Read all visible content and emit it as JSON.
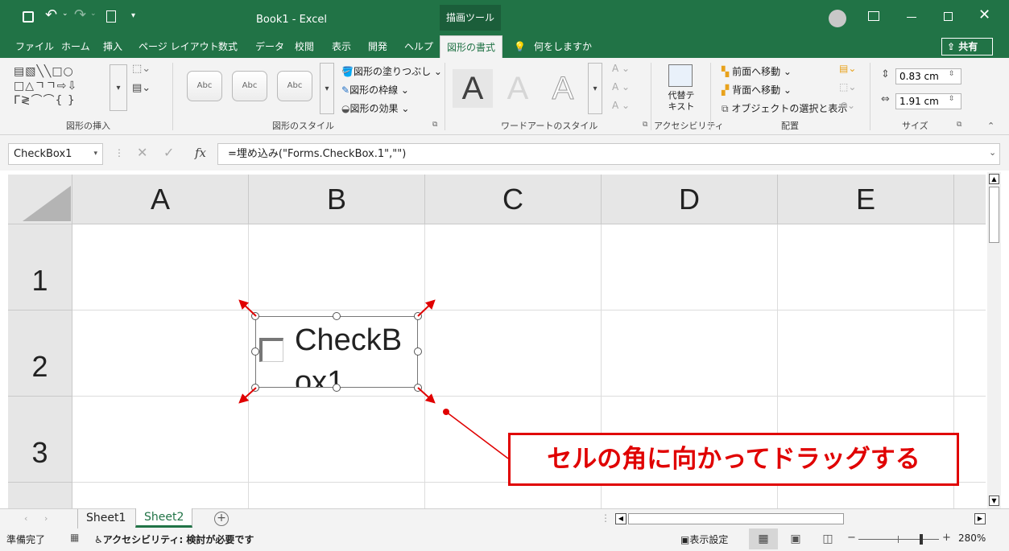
{
  "title": {
    "app_title": "Book1  -  Excel",
    "context_tab": "描画ツール"
  },
  "tabs": [
    "ファイル",
    "ホーム",
    "挿入",
    "ページ レイアウト",
    "数式",
    "データ",
    "校閲",
    "表示",
    "開発",
    "ヘルプ",
    "図形の書式"
  ],
  "tell_me": "何をしますか",
  "share": "共有",
  "ribbon": {
    "groups": [
      "図形の挿入",
      "図形のスタイル",
      "ワードアートのスタイル",
      "アクセシビリティ",
      "配置",
      "サイズ"
    ],
    "style_thumb": "Abc",
    "fill": "図形の塗りつぶし",
    "outline": "図形の枠線",
    "effect": "図形の効果",
    "wordart_letter": "A",
    "alt_text": "代替テキスト",
    "bring_forward": "前面へ移動",
    "send_backward": "背面へ移動",
    "selection_pane": "オブジェクトの選択と表示",
    "height": "0.83 cm",
    "width": "1.91 cm"
  },
  "formula_bar": {
    "name_box": "CheckBox1",
    "fx": "fx",
    "formula": "=埋め込み(\"Forms.CheckBox.1\",\"\")"
  },
  "columns": [
    "A",
    "B",
    "C",
    "D",
    "E"
  ],
  "rows": [
    "1",
    "2",
    "3"
  ],
  "checkbox": {
    "caption_line1": "CheckB",
    "caption_line2": "ox1"
  },
  "callout": "セルの角に向かってドラッグする",
  "sheets": [
    "Sheet1",
    "Sheet2"
  ],
  "active_sheet": "Sheet2",
  "status": {
    "ready": "準備完了",
    "accessibility": "アクセシビリティ: 検討が必要です",
    "display_settings": "表示設定",
    "zoom": "280%"
  },
  "colors": {
    "excel_green": "#217346",
    "annotation_red": "#e00000"
  }
}
